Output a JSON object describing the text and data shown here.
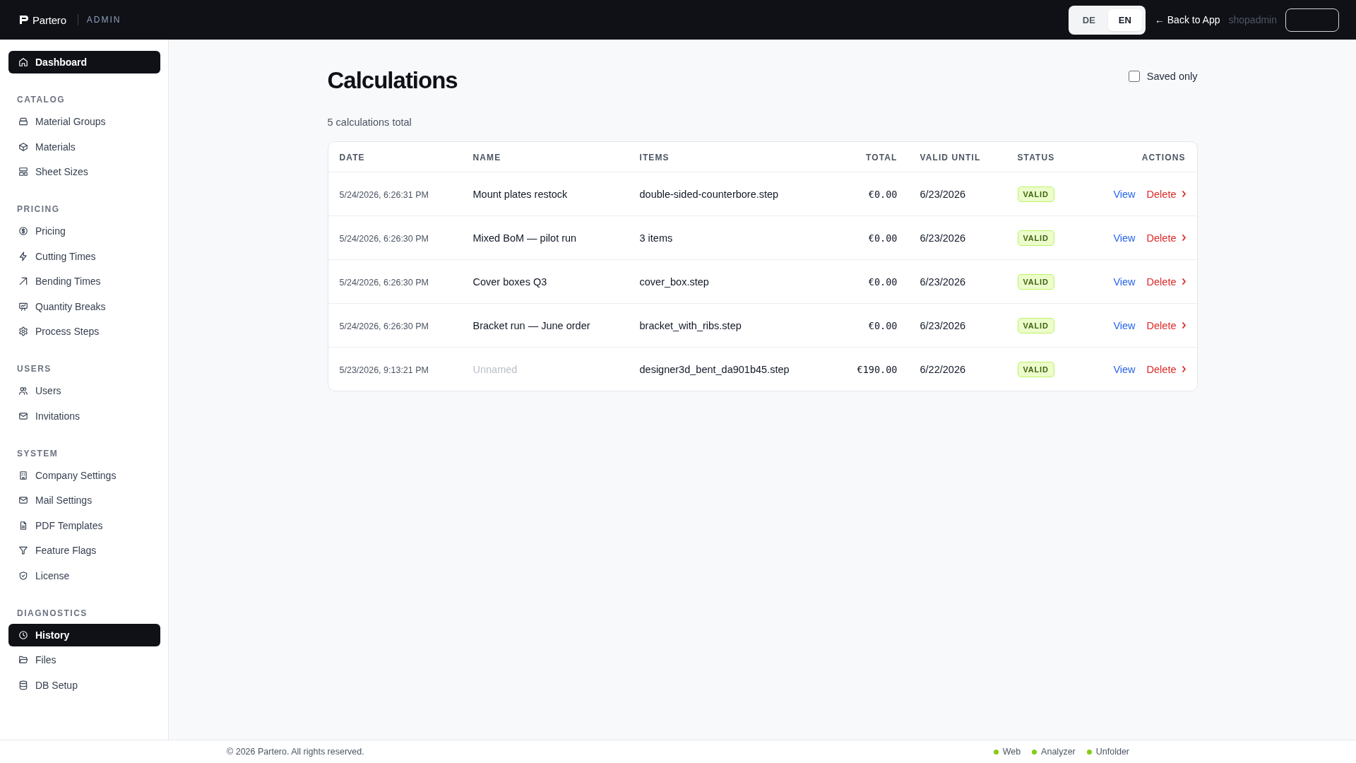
{
  "header": {
    "brand": "Partero",
    "section_label": "ADMIN",
    "languages": [
      {
        "label": "DE",
        "selected": false
      },
      {
        "label": "EN",
        "selected": true
      }
    ],
    "back_link": "← Back to App",
    "username": "shopadmin"
  },
  "sidebar": {
    "items": [
      {
        "label": "Dashboard",
        "selected": true
      }
    ],
    "sections": [
      {
        "title": "CATALOG",
        "items": [
          {
            "label": "Material Groups",
            "selected": false
          },
          {
            "label": "Materials",
            "selected": false
          },
          {
            "label": "Sheet Sizes",
            "selected": false
          }
        ]
      },
      {
        "title": "PRICING",
        "items": [
          {
            "label": "Pricing",
            "selected": false
          },
          {
            "label": "Cutting Times",
            "selected": false
          },
          {
            "label": "Bending Times",
            "selected": false
          },
          {
            "label": "Quantity Breaks",
            "selected": false
          },
          {
            "label": "Process Steps",
            "selected": false
          }
        ]
      },
      {
        "title": "USERS",
        "items": [
          {
            "label": "Users",
            "selected": false
          },
          {
            "label": "Invitations",
            "selected": false
          }
        ]
      },
      {
        "title": "SYSTEM",
        "items": [
          {
            "label": "Company Settings",
            "selected": false
          },
          {
            "label": "Mail Settings",
            "selected": false
          },
          {
            "label": "PDF Templates",
            "selected": false
          },
          {
            "label": "Feature Flags",
            "selected": false
          },
          {
            "label": "License",
            "selected": false
          }
        ]
      },
      {
        "title": "DIAGNOSTICS",
        "items": [
          {
            "label": "History",
            "selected": true
          },
          {
            "label": "Files",
            "selected": false
          },
          {
            "label": "DB Setup",
            "selected": false
          }
        ]
      }
    ]
  },
  "page": {
    "title": "Calculations",
    "saved_only": {
      "label": "Saved only",
      "checked": false
    },
    "summary": "5 calculations total",
    "table": {
      "columns": [
        "DATE",
        "NAME",
        "ITEMS",
        "TOTAL",
        "VALID UNTIL",
        "STATUS",
        "ACTIONS"
      ],
      "rows": [
        {
          "date": "5/24/2026, 6:26:31 PM",
          "name": "Mount plates restock",
          "muted": false,
          "items": "double-sided-counterbore.step",
          "total": "€0.00",
          "valid_until": "6/23/2026",
          "status": "VALID",
          "view": "View",
          "delete": "Delete"
        },
        {
          "date": "5/24/2026, 6:26:30 PM",
          "name": "Mixed BoM — pilot run",
          "muted": false,
          "items": "3 items",
          "total": "€0.00",
          "valid_until": "6/23/2026",
          "status": "VALID",
          "view": "View",
          "delete": "Delete"
        },
        {
          "date": "5/24/2026, 6:26:30 PM",
          "name": "Cover boxes Q3",
          "muted": false,
          "items": "cover_box.step",
          "total": "€0.00",
          "valid_until": "6/23/2026",
          "status": "VALID",
          "view": "View",
          "delete": "Delete"
        },
        {
          "date": "5/24/2026, 6:26:30 PM",
          "name": "Bracket run — June order",
          "muted": false,
          "items": "bracket_with_ribs.step",
          "total": "€0.00",
          "valid_until": "6/23/2026",
          "status": "VALID",
          "view": "View",
          "delete": "Delete"
        },
        {
          "date": "5/23/2026, 9:13:21 PM",
          "name": "Unnamed",
          "muted": true,
          "items": "designer3d_bent_da901b45.step",
          "total": "€190.00",
          "valid_until": "6/22/2026",
          "status": "VALID",
          "view": "View",
          "delete": "Delete"
        }
      ]
    }
  },
  "footer": {
    "copyright": "© 2026 Partero. All rights reserved.",
    "services": [
      {
        "label": "Web",
        "color": "#84cc16"
      },
      {
        "label": "Analyzer",
        "color": "#84cc16"
      },
      {
        "label": "Unfolder",
        "color": "#84cc16"
      }
    ]
  }
}
